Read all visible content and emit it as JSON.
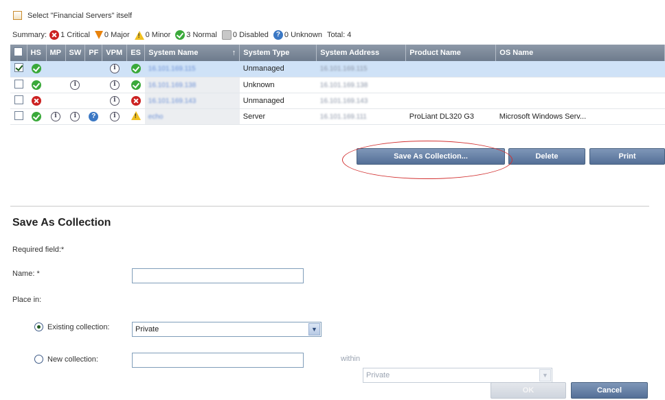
{
  "select_itself": {
    "label": "Select \"Financial Servers\" itself"
  },
  "summary": {
    "prefix": "Summary:",
    "critical": "1 Critical",
    "major": "0 Major",
    "minor": "0 Minor",
    "normal": "3 Normal",
    "disabled": "0 Disabled",
    "unknown": "0 Unknown",
    "total": "Total: 4"
  },
  "table": {
    "columns": [
      "",
      "HS",
      "MP",
      "SW",
      "PF",
      "VPM",
      "ES",
      "System Name",
      "System Type",
      "System Address",
      "Product Name",
      "OS Name"
    ],
    "sort_indicator": "↑",
    "rows": [
      {
        "checked": true,
        "selected": true,
        "hs": "green",
        "mp": "",
        "sw": "",
        "pf": "",
        "vpm": "info",
        "es": "green",
        "name": "16.101.169.115",
        "type": "Unmanaged",
        "address": "16.101.169.115",
        "product": "",
        "os": ""
      },
      {
        "checked": false,
        "selected": false,
        "hs": "green",
        "mp": "",
        "sw": "info",
        "pf": "",
        "vpm": "info",
        "es": "green",
        "name": "16.101.169.138",
        "type": "Unknown",
        "address": "16.101.169.138",
        "product": "",
        "os": ""
      },
      {
        "checked": false,
        "selected": false,
        "hs": "red",
        "mp": "",
        "sw": "",
        "pf": "",
        "vpm": "info",
        "es": "red",
        "name": "16.101.169.143",
        "type": "Unmanaged",
        "address": "16.101.169.143",
        "product": "",
        "os": ""
      },
      {
        "checked": false,
        "selected": false,
        "hs": "green",
        "mp": "info",
        "sw": "info",
        "pf": "blue",
        "vpm": "info",
        "es": "warn",
        "name": "echo",
        "type": "Server",
        "address": "16.101.169.111",
        "product": "ProLiant DL320 G3",
        "os": "Microsoft Windows Serv..."
      }
    ]
  },
  "actions": {
    "save_as_collection": "Save As Collection...",
    "delete": "Delete",
    "print": "Print"
  },
  "form": {
    "title": "Save As Collection",
    "required_note": "Required field:*",
    "name_label": "Name: *",
    "name_value": "",
    "place_in_label": "Place in:",
    "existing_label": "Existing collection:",
    "existing_value": "Private",
    "new_label": "New collection:",
    "new_value": "",
    "within_label": "within",
    "within_value": "Private",
    "ok": "OK",
    "cancel": "Cancel"
  },
  "colors": {
    "header_bg": "#7a8797",
    "selected_row": "#cfe2f7",
    "button": "#5b77a0",
    "highlight": "#d23030"
  }
}
